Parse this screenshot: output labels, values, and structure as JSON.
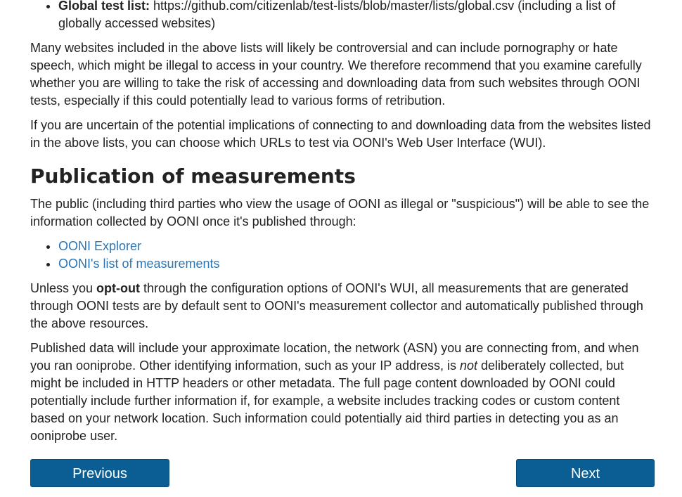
{
  "test_lists": {
    "global_label": "Global test list:",
    "global_text": " https://github.com/citizenlab/test-lists/blob/master/lists/global.csv (including a list of globally accessed websites)"
  },
  "paragraphs": {
    "controversial": "Many websites included in the above lists will likely be controversial and can include pornography or hate speech, which might be illegal to access in your country. We therefore recommend that you examine carefully whether you are willing to take the risk of accessing and downloading data from such websites through OONI tests, especially if this could potentially lead to various forms of retribution.",
    "uncertain": "If you are uncertain of the potential implications of connecting to and downloading data from the websites listed in the above lists, you can choose which URLs to test via OONI's Web User Interface (WUI)."
  },
  "publication": {
    "heading": "Publication of measurements",
    "intro": "The public (including third parties who view the usage of OONI as illegal or \"suspicious\") will be able to see the information collected by OONI once it's published through:",
    "links": [
      "OONI Explorer",
      "OONI's list of measurements"
    ],
    "optout_before": "Unless you ",
    "optout_bold": "opt-out",
    "optout_after": " through the configuration options of OONI's WUI, all measurements that are generated through OONI tests are by default sent to OONI's measurement collector and automatically published through the above resources.",
    "published_before": "Published data will include your approximate location, the network (ASN) you are connecting from, and when you ran ooniprobe. Other identifying information, such as your IP address, is ",
    "published_em": "not",
    "published_after": " deliberately collected, but might be included in HTTP headers or other metadata. The full page content downloaded by OONI could potentially include further information if, for example, a website includes tracking codes or custom content based on your network location. Such information could potentially aid third parties in detecting you as an ooniprobe user."
  },
  "nav": {
    "previous_label": "Previous",
    "next_label": "Next"
  }
}
